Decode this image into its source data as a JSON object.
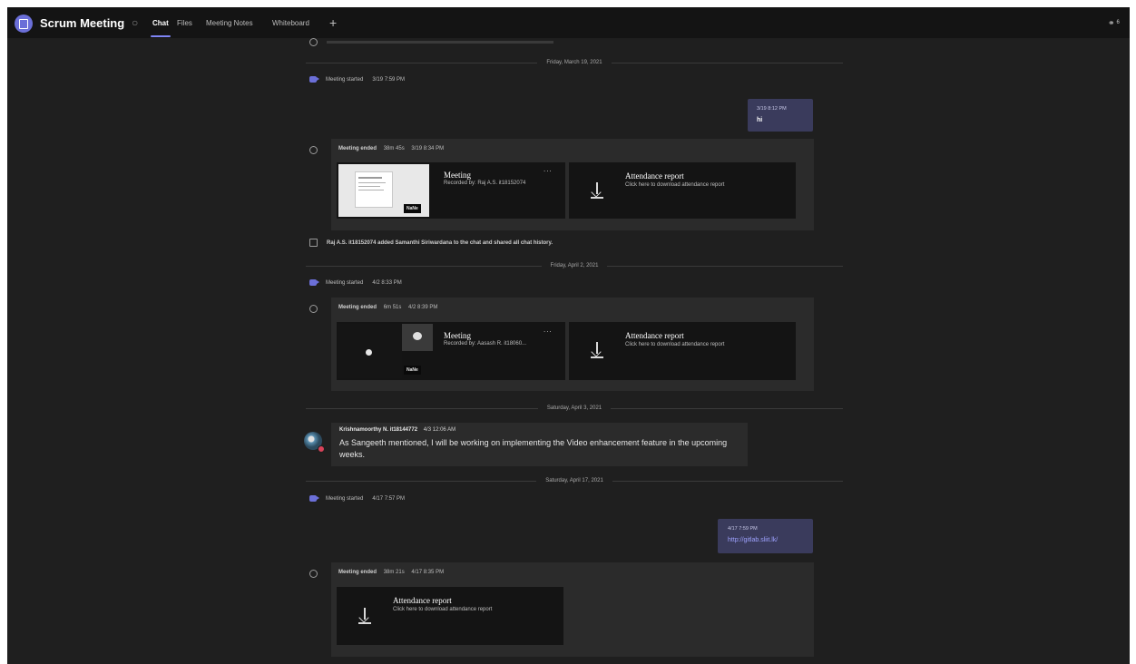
{
  "header": {
    "title": "Scrum Meeting",
    "tabs": [
      {
        "label": "Chat",
        "active": true
      },
      {
        "label": "Files"
      },
      {
        "label": "Meeting Notes"
      },
      {
        "label": "Whiteboard"
      }
    ],
    "add_tab": "+",
    "participants_count": "6"
  },
  "feed": {
    "top_partial": "",
    "day1": {
      "date": "Friday, March 19, 2021",
      "meeting_started": {
        "label": "Meeting started",
        "time": "3/19 7:59 PM"
      },
      "my_message": {
        "time": "3/19 8:12 PM",
        "text": "hi"
      },
      "meeting_ended": {
        "label": "Meeting ended",
        "duration": "38m 45s",
        "time": "3/19 8:34 PM"
      },
      "recording": {
        "title": "Meeting",
        "by": "Recorded by: Raj A.S. it18152074",
        "badge": "NaNe",
        "more": "..."
      },
      "attendance": {
        "title": "Attendance report",
        "subtitle": "Click here to download attendance report"
      },
      "added_event": "Raj A.S. it18152074 added Samanthi Siriwardana to the chat and shared all chat history."
    },
    "day2": {
      "date": "Friday, April 2, 2021",
      "meeting_started": {
        "label": "Meeting started",
        "time": "4/2 8:33 PM"
      },
      "meeting_ended": {
        "label": "Meeting ended",
        "duration": "6m 51s",
        "time": "4/2 8:39 PM"
      },
      "recording": {
        "title": "Meeting",
        "by": "Recorded by: Aasash R. it18060...",
        "badge": "NaNe",
        "more": "..."
      },
      "attendance": {
        "title": "Attendance report",
        "subtitle": "Click here to download attendance report"
      }
    },
    "day3": {
      "date": "Saturday, April 3, 2021",
      "message": {
        "author": "Krishnamoorthy N. it18144772",
        "time": "4/3 12:06 AM",
        "text": "As Sangeeth mentioned, I will be working on implementing the Video enhancement feature in the upcoming weeks."
      }
    },
    "day4": {
      "date": "Saturday, April 17, 2021",
      "meeting_started": {
        "label": "Meeting started",
        "time": "4/17 7:57 PM"
      },
      "my_message": {
        "time": "4/17 7:59 PM",
        "link": "http://gitlab.sliit.lk/"
      },
      "meeting_ended": {
        "label": "Meeting ended",
        "duration": "38m 21s",
        "time": "4/17 8:35 PM"
      },
      "attendance": {
        "title": "Attendance report",
        "subtitle": "Click here to download attendance report"
      }
    }
  },
  "colors": {
    "accent": "#7f85f5",
    "background": "#1f1f1f",
    "panel": "#2b2b2b",
    "card": "#141414",
    "my_bubble": "#3a3b5c"
  }
}
